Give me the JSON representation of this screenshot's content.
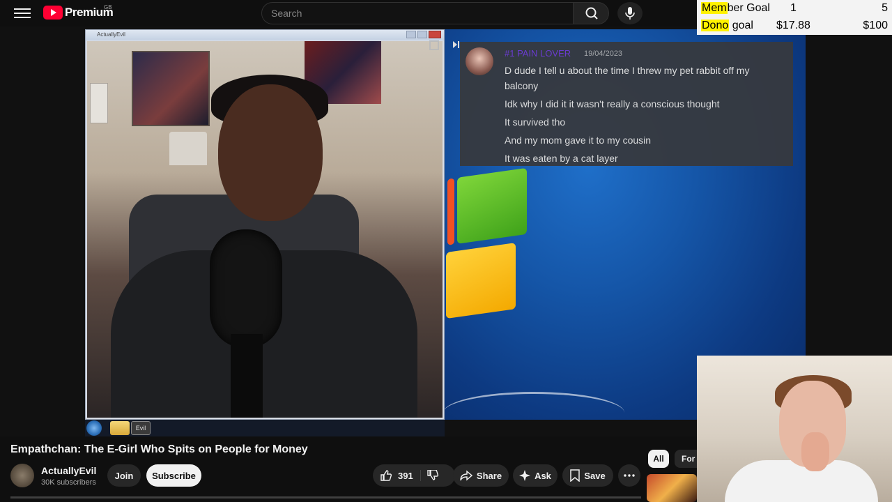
{
  "header": {
    "logo_text": "Premium",
    "region": "GB",
    "search_placeholder": "Search"
  },
  "goals": {
    "member": {
      "label_hl": "Mem",
      "label_rest": "ber Goal",
      "current": "1",
      "target": "5"
    },
    "dono": {
      "label_hl": "Dono",
      "label_rest": " goal",
      "current": "$17.88",
      "target": "$100"
    }
  },
  "stream": {
    "cam_window_title": "ActuallyEvil",
    "taskbar_evil_label": "Evil",
    "chat": {
      "username": "#1 PAIN LOVER",
      "date": "19/04/2023",
      "messages": [
        "D dude I tell u about the time I threw my pet rabbit off my balcony",
        "Idk why I did it it wasn't really a conscious thought",
        "It survived tho",
        "And my mom gave it to my cousin",
        "It was eaten by a cat layer"
      ]
    }
  },
  "video": {
    "title": "Empathchan: The E-Girl Who Spits on People for Money",
    "channel": "ActuallyEvil",
    "subscribers": "30K subscribers",
    "join_label": "Join",
    "subscribe_label": "Subscribe",
    "likes": "391",
    "share_label": "Share",
    "ask_label": "Ask",
    "save_label": "Save"
  },
  "sidebar_chips": {
    "all": "All",
    "for_you": "For y"
  },
  "colors": {
    "brand": "#ff0033",
    "background": "#0f0f0f",
    "pill": "#272727",
    "chat_username": "#6a3bd1",
    "goal_highlight": "#fff200"
  }
}
